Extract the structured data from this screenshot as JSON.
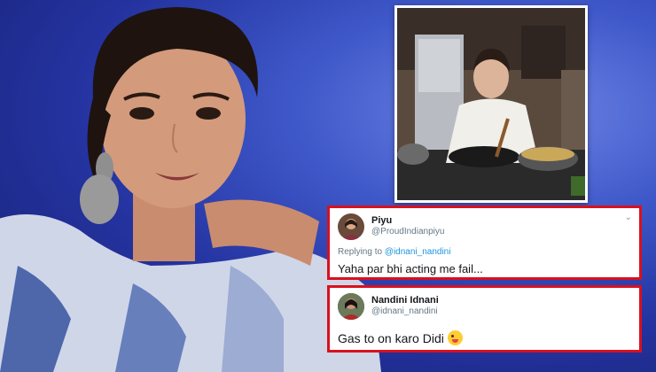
{
  "tweets": [
    {
      "name": "Piyu",
      "handle": "@ProudIndianpiyu",
      "replying_prefix": "Replying to ",
      "replying_to": "@idnani_nandini",
      "text": "Yaha par bhi acting me fail..."
    },
    {
      "name": "Nandini Idnani",
      "handle": "@idnani_nandini",
      "text": "Gas to on karo Didi"
    }
  ],
  "colors": {
    "background": "#2433a0",
    "tweet_border": "#d9101e",
    "mention": "#1b95e0"
  },
  "icons": [
    "chevron-down-icon",
    "tongue-emoji-icon"
  ]
}
